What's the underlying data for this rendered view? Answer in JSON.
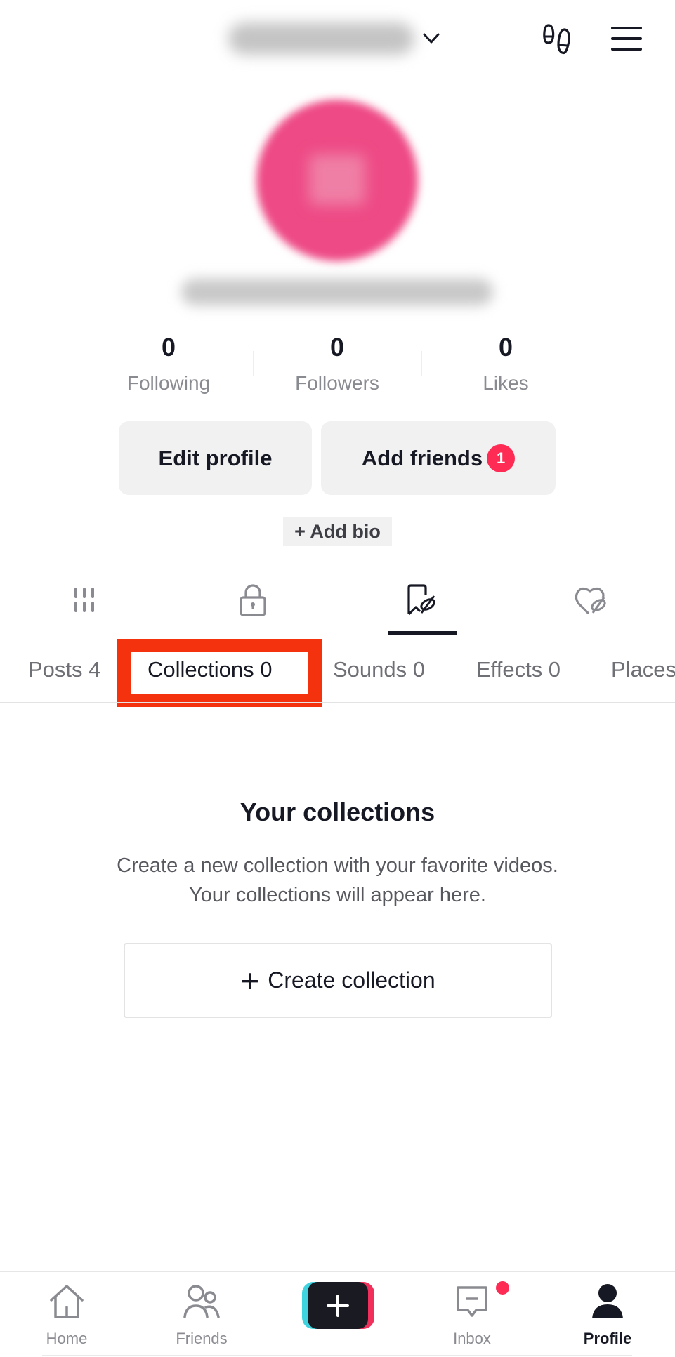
{
  "header": {
    "username_blurred": true,
    "icons": [
      "chevron-down",
      "footprints",
      "menu"
    ]
  },
  "profile": {
    "avatar_color": "#ee4a85",
    "stats": [
      {
        "value": "0",
        "label": "Following"
      },
      {
        "value": "0",
        "label": "Followers"
      },
      {
        "value": "0",
        "label": "Likes"
      }
    ],
    "edit_profile_label": "Edit profile",
    "add_friends_label": "Add friends",
    "add_friends_badge": "1",
    "add_bio_label": "+ Add bio"
  },
  "icon_tabs": [
    {
      "icon": "grid",
      "active": false
    },
    {
      "icon": "lock",
      "active": false
    },
    {
      "icon": "bookmark-hidden",
      "active": true
    },
    {
      "icon": "heart-hidden",
      "active": false
    }
  ],
  "sub_tabs": [
    {
      "label": "Posts 4",
      "active": false
    },
    {
      "label": "Collections 0",
      "active": true,
      "highlighted": true
    },
    {
      "label": "Sounds 0",
      "active": false
    },
    {
      "label": "Effects 0",
      "active": false
    },
    {
      "label": "Places",
      "active": false
    }
  ],
  "empty_state": {
    "title": "Your collections",
    "description_line1": "Create a new collection with your favorite videos.",
    "description_line2": "Your collections will appear here.",
    "create_button_icon": "+",
    "create_button_label": "Create collection"
  },
  "bottom_nav": [
    {
      "label": "Home",
      "icon": "home",
      "active": false
    },
    {
      "label": "Friends",
      "icon": "friends",
      "active": false
    },
    {
      "label": "",
      "icon": "create",
      "active": false
    },
    {
      "label": "Inbox",
      "icon": "inbox",
      "active": false,
      "has_notification_dot": true
    },
    {
      "label": "Profile",
      "icon": "profile",
      "active": true
    }
  ],
  "colors": {
    "accent_red": "#fe2c55",
    "highlight_box": "#f5320e",
    "text_primary": "#161823",
    "text_secondary": "#8a8b91"
  }
}
